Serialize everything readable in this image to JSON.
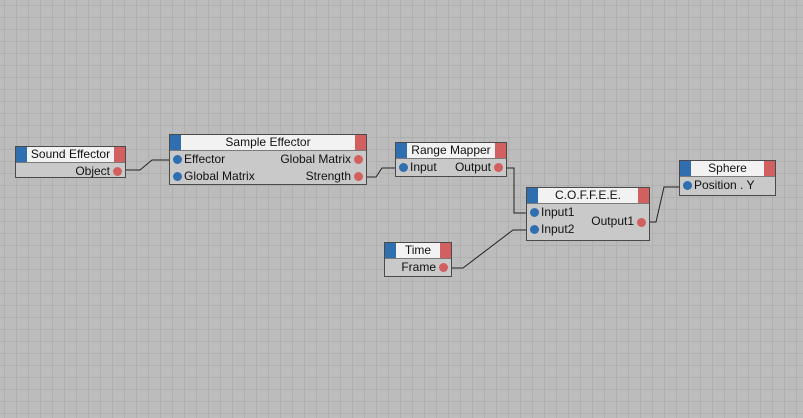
{
  "nodes": {
    "sound_effector": {
      "title": "Sound Effector",
      "outputs": [
        "Object"
      ]
    },
    "sample_effector": {
      "title": "Sample Effector",
      "inputs": [
        "Effector",
        "Global Matrix"
      ],
      "outputs": [
        "Global Matrix",
        "Strength"
      ]
    },
    "range_mapper": {
      "title": "Range Mapper",
      "inputs": [
        "Input"
      ],
      "outputs": [
        "Output"
      ]
    },
    "coffee": {
      "title": "C.O.F.F.E.E.",
      "inputs": [
        "Input1",
        "Input2"
      ],
      "outputs": [
        "Output1"
      ]
    },
    "time": {
      "title": "Time",
      "outputs": [
        "Frame"
      ]
    },
    "sphere": {
      "title": "Sphere",
      "inputs": [
        "Position . Y"
      ]
    }
  },
  "connections": [
    {
      "from": "Sound Effector.Object",
      "to": "Sample Effector.Effector"
    },
    {
      "from": "Sample Effector.Strength",
      "to": "Range Mapper.Input"
    },
    {
      "from": "Range Mapper.Output",
      "to": "C.O.F.F.E.E..Input1"
    },
    {
      "from": "Time.Frame",
      "to": "C.O.F.F.E.E..Input2"
    },
    {
      "from": "C.O.F.F.E.E..Output1",
      "to": "Sphere.Position . Y"
    }
  ],
  "colors": {
    "canvas": "#bcbcbc",
    "node_body": "#c9c9c9",
    "title_bar": "#f2f2f2",
    "input_port": "#2f6fb0",
    "output_port": "#d36060",
    "wire": "#222222"
  }
}
